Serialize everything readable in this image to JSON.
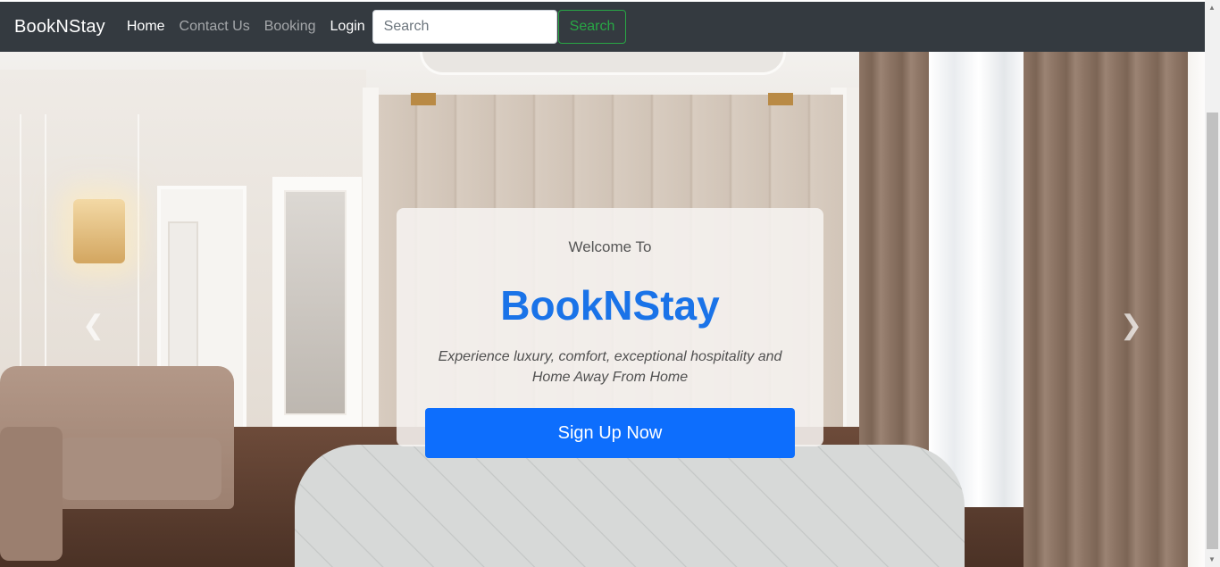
{
  "navbar": {
    "brand": "BookNStay",
    "links": [
      {
        "label": "Home",
        "active": true
      },
      {
        "label": "Contact Us",
        "active": false
      },
      {
        "label": "Booking",
        "active": false
      },
      {
        "label": "Login",
        "active": true
      }
    ],
    "search_placeholder": "Search",
    "search_value": "",
    "search_button": "Search"
  },
  "hero": {
    "welcome": "Welcome To",
    "title": "BookNStay",
    "tagline": "Experience luxury, comfort, exceptional hospitality and Home Away From Home",
    "signup_button": "Sign Up Now",
    "prev_icon": "chevron-left-icon",
    "next_icon": "chevron-right-icon"
  },
  "colors": {
    "navbar_bg": "#343a40",
    "title": "#1a73e8",
    "primary_button": "#0d6efd",
    "search_button": "#28a745"
  }
}
